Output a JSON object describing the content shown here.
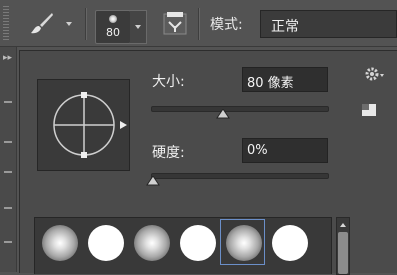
{
  "toolbar": {
    "brush_preset_size": "80",
    "mode_label": "模式:",
    "mode_value": "正常"
  },
  "brush_panel": {
    "size_label": "大小:",
    "size_value": "80 像素",
    "size_slider_fraction": 0.29,
    "hardness_label": "硬度:",
    "hardness_value": "0%",
    "hardness_slider_fraction": 0.0
  },
  "brush_presets": [
    {
      "type": "soft",
      "selected": false
    },
    {
      "type": "hard",
      "selected": false
    },
    {
      "type": "soft",
      "selected": false
    },
    {
      "type": "hard",
      "selected": false
    },
    {
      "type": "soft",
      "selected": true
    },
    {
      "type": "hard",
      "selected": false
    }
  ],
  "icons": {
    "tool": "brush-icon",
    "panel_toggle": "brush-panel-toggle-icon",
    "settings": "gear-icon",
    "new_preset": "new-preset-icon",
    "preview": "brush-angle-roundness-icon"
  },
  "colors": {
    "background": "#535353",
    "panel": "#4b4b4b",
    "field": "#2f2f2f",
    "selection": "#6b8fc9"
  }
}
